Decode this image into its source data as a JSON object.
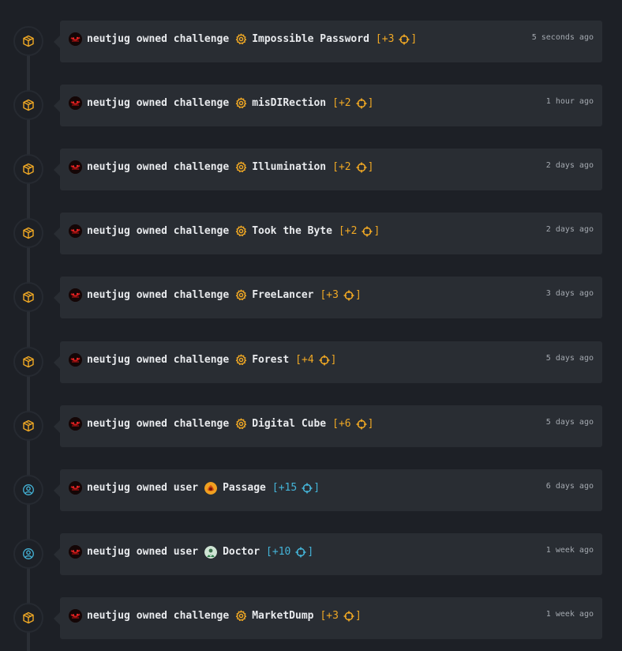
{
  "colors": {
    "accent_challenge": "#f0a824",
    "accent_user": "#44b4d8",
    "card_bg": "#292d33",
    "page_bg": "#1d2026"
  },
  "entries": [
    {
      "user": "neutjug",
      "action": "owned challenge",
      "kind": "challenge",
      "target": "Impossible Password",
      "points": "[+3",
      "close": "]",
      "time": "5 seconds ago",
      "node_icon": "box-icon"
    },
    {
      "user": "neutjug",
      "action": "owned challenge",
      "kind": "challenge",
      "target": "misDIRection",
      "points": "[+2",
      "close": "]",
      "time": "1 hour ago",
      "node_icon": "box-icon"
    },
    {
      "user": "neutjug",
      "action": "owned challenge",
      "kind": "challenge",
      "target": "Illumination",
      "points": "[+2",
      "close": "]",
      "time": "2 days ago",
      "node_icon": "box-icon"
    },
    {
      "user": "neutjug",
      "action": "owned challenge",
      "kind": "challenge",
      "target": "Took the Byte",
      "points": "[+2",
      "close": "]",
      "time": "2 days ago",
      "node_icon": "box-icon"
    },
    {
      "user": "neutjug",
      "action": "owned challenge",
      "kind": "challenge",
      "target": "FreeLancer",
      "points": "[+3",
      "close": "]",
      "time": "3 days ago",
      "node_icon": "box-icon"
    },
    {
      "user": "neutjug",
      "action": "owned challenge",
      "kind": "challenge",
      "target": "Forest",
      "points": "[+4",
      "close": "]",
      "time": "5 days ago",
      "node_icon": "box-icon"
    },
    {
      "user": "neutjug",
      "action": "owned challenge",
      "kind": "challenge",
      "target": "Digital Cube",
      "points": "[+6",
      "close": "]",
      "time": "5 days ago",
      "node_icon": "box-icon"
    },
    {
      "user": "neutjug",
      "action": "owned user",
      "kind": "user",
      "target": "Passage",
      "points": "[+15",
      "close": "]",
      "time": "6 days ago",
      "node_icon": "user-icon"
    },
    {
      "user": "neutjug",
      "action": "owned user",
      "kind": "user",
      "target": "Doctor",
      "points": "[+10",
      "close": "]",
      "time": "1 week ago",
      "node_icon": "user-icon"
    },
    {
      "user": "neutjug",
      "action": "owned challenge",
      "kind": "challenge",
      "target": "MarketDump",
      "points": "[+3",
      "close": "]",
      "time": "1 week ago",
      "node_icon": "box-icon"
    }
  ]
}
